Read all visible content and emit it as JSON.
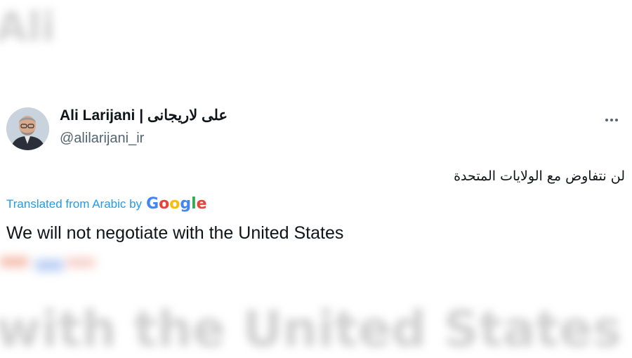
{
  "background_text": {
    "top": "Ali",
    "bottom": "with the United States"
  },
  "tweet": {
    "author": {
      "display_name": "Ali Larijani | علی لاریجانی",
      "handle": "@alilarijani_ir",
      "avatar_icon": "avatar-photo"
    },
    "more_icon": "more-horizontal-icon",
    "original_text": "لن نتفاوض مع الولايات المتحدة",
    "translation_label": "Translated from Arabic by",
    "translation_provider": "Google",
    "translated_text": "We will not negotiate with the United States"
  },
  "colors": {
    "text_primary": "#0f1419",
    "text_secondary": "#536471",
    "link_blue": "#1d9bf0",
    "google_blue": "#4285f4",
    "google_red": "#ea4335",
    "google_yellow": "#fbbc05",
    "google_green": "#34a853"
  }
}
